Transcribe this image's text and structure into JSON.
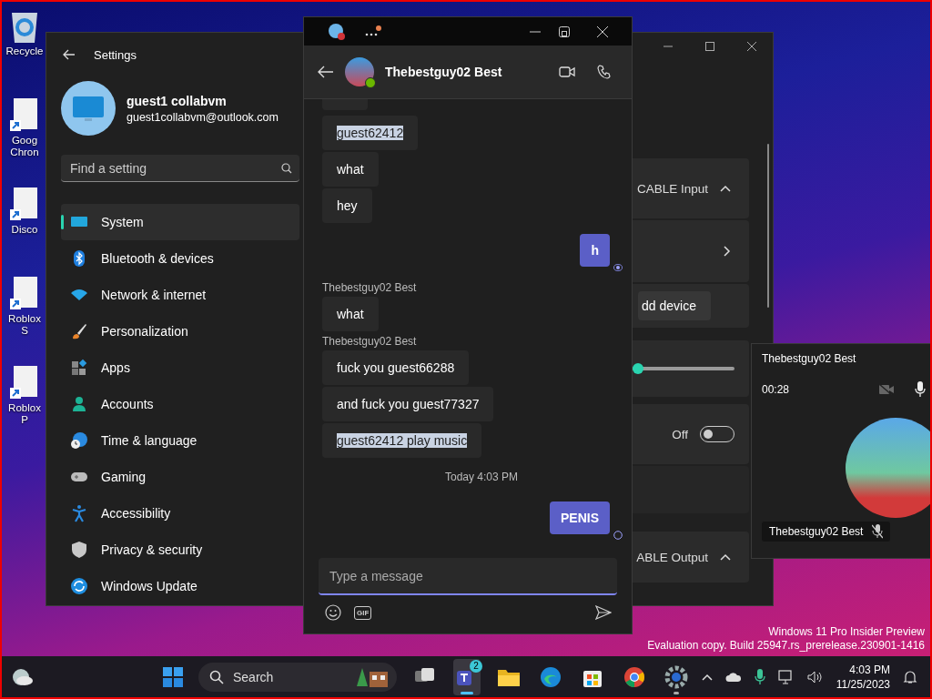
{
  "desktop": {
    "icons": [
      {
        "label": "Recycle",
        "kind": "recycle"
      },
      {
        "label": "Goog Chron",
        "kind": "shortcut"
      },
      {
        "label": "Disco",
        "kind": "shortcut"
      },
      {
        "label": "Roblox S",
        "kind": "shortcut"
      },
      {
        "label": "Roblox P",
        "kind": "shortcut"
      }
    ],
    "watermark": [
      "Windows 11 Pro Insider Preview",
      "Evaluation copy. Build 25947.rs_prerelease.230901-1416"
    ]
  },
  "settings": {
    "title": "Settings",
    "user": {
      "name": "guest1 collabvm",
      "email": "guest1collabvm@outlook.com"
    },
    "search": {
      "placeholder": "Find a setting"
    },
    "nav": [
      {
        "label": "System",
        "kind": "system",
        "selected": true
      },
      {
        "label": "Bluetooth & devices",
        "kind": "bluetooth",
        "selected": false
      },
      {
        "label": "Network & internet",
        "kind": "network",
        "selected": false
      },
      {
        "label": "Personalization",
        "kind": "brush",
        "selected": false
      },
      {
        "label": "Apps",
        "kind": "apps",
        "selected": false
      },
      {
        "label": "Accounts",
        "kind": "accounts",
        "selected": false
      },
      {
        "label": "Time & language",
        "kind": "time",
        "selected": false
      },
      {
        "label": "Gaming",
        "kind": "gaming",
        "selected": false
      },
      {
        "label": "Accessibility",
        "kind": "accessibility",
        "selected": false
      },
      {
        "label": "Privacy & security",
        "kind": "privacy",
        "selected": false
      },
      {
        "label": "Windows Update",
        "kind": "update",
        "selected": false
      }
    ],
    "cards": [
      {
        "kind": "dropdown",
        "value": "CABLE Input",
        "expanded": true
      },
      {
        "kind": "link"
      },
      {
        "kind": "button",
        "label": "dd device"
      },
      {
        "kind": "slider",
        "level": 0.05
      },
      {
        "kind": "toggle",
        "state_label": "Off",
        "on": false
      },
      {
        "kind": "blank"
      },
      {
        "kind": "dropdown",
        "value": "ABLE Output",
        "expanded": true
      }
    ]
  },
  "teams": {
    "contact": "Thebestguy02 Best",
    "messages": [
      {
        "kind": "received",
        "text": "guest62412",
        "highlighted": true
      },
      {
        "kind": "received",
        "text": "what",
        "highlighted": false
      },
      {
        "kind": "received",
        "text": "hey",
        "highlighted": false
      },
      {
        "kind": "sent",
        "text": "h",
        "seen": true
      },
      {
        "kind": "sender",
        "text": "Thebestguy02 Best"
      },
      {
        "kind": "received",
        "text": "what",
        "highlighted": false
      },
      {
        "kind": "sender",
        "text": "Thebestguy02 Best"
      },
      {
        "kind": "received",
        "text": "fuck you guest66288",
        "highlighted": false
      },
      {
        "kind": "received",
        "text": "and fuck you guest77327",
        "highlighted": false
      },
      {
        "kind": "received",
        "text": "guest62412 play music",
        "highlighted": true
      },
      {
        "kind": "timestamp",
        "text": "Today 4:03 PM"
      },
      {
        "kind": "sent",
        "text": "PENIS",
        "seen": false
      }
    ],
    "composer": {
      "placeholder": "Type a message"
    },
    "gif": "GIF"
  },
  "call": {
    "name": "Thebestguy02 Best",
    "duration": "00:28",
    "camera_on": false,
    "mic_muted": false,
    "participant": {
      "name": "Thebestguy02 Best",
      "muted": true
    }
  },
  "taskbar": {
    "search": {
      "placeholder": "Search"
    },
    "apps": [
      {
        "kind": "taskview",
        "selected": false,
        "running": false
      },
      {
        "kind": "teams",
        "selected": true,
        "running": true,
        "badge": "2"
      },
      {
        "kind": "explorer",
        "selected": false,
        "running": false
      },
      {
        "kind": "edge",
        "selected": false,
        "running": false
      },
      {
        "kind": "store",
        "selected": false,
        "running": false
      },
      {
        "kind": "chrome",
        "selected": false,
        "running": false
      },
      {
        "kind": "settings",
        "selected": false,
        "running": true
      }
    ],
    "time": "4:03 PM",
    "date": "11/25/2023"
  }
}
